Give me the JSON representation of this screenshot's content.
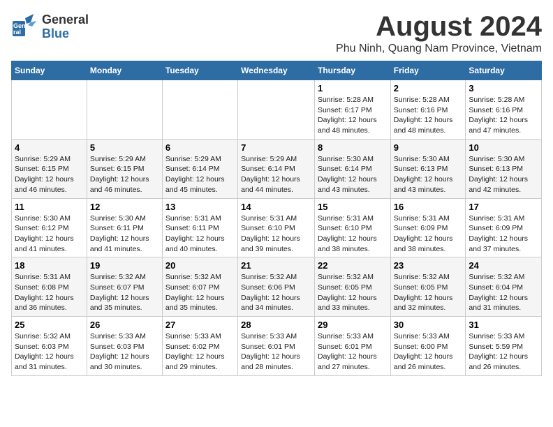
{
  "logo": {
    "line1": "General",
    "line2": "Blue"
  },
  "title": "August 2024",
  "location": "Phu Ninh, Quang Nam Province, Vietnam",
  "days_of_week": [
    "Sunday",
    "Monday",
    "Tuesday",
    "Wednesday",
    "Thursday",
    "Friday",
    "Saturday"
  ],
  "weeks": [
    [
      {
        "day": "",
        "info": ""
      },
      {
        "day": "",
        "info": ""
      },
      {
        "day": "",
        "info": ""
      },
      {
        "day": "",
        "info": ""
      },
      {
        "day": "1",
        "info": "Sunrise: 5:28 AM\nSunset: 6:17 PM\nDaylight: 12 hours\nand 48 minutes."
      },
      {
        "day": "2",
        "info": "Sunrise: 5:28 AM\nSunset: 6:16 PM\nDaylight: 12 hours\nand 48 minutes."
      },
      {
        "day": "3",
        "info": "Sunrise: 5:28 AM\nSunset: 6:16 PM\nDaylight: 12 hours\nand 47 minutes."
      }
    ],
    [
      {
        "day": "4",
        "info": "Sunrise: 5:29 AM\nSunset: 6:15 PM\nDaylight: 12 hours\nand 46 minutes."
      },
      {
        "day": "5",
        "info": "Sunrise: 5:29 AM\nSunset: 6:15 PM\nDaylight: 12 hours\nand 46 minutes."
      },
      {
        "day": "6",
        "info": "Sunrise: 5:29 AM\nSunset: 6:14 PM\nDaylight: 12 hours\nand 45 minutes."
      },
      {
        "day": "7",
        "info": "Sunrise: 5:29 AM\nSunset: 6:14 PM\nDaylight: 12 hours\nand 44 minutes."
      },
      {
        "day": "8",
        "info": "Sunrise: 5:30 AM\nSunset: 6:14 PM\nDaylight: 12 hours\nand 43 minutes."
      },
      {
        "day": "9",
        "info": "Sunrise: 5:30 AM\nSunset: 6:13 PM\nDaylight: 12 hours\nand 43 minutes."
      },
      {
        "day": "10",
        "info": "Sunrise: 5:30 AM\nSunset: 6:13 PM\nDaylight: 12 hours\nand 42 minutes."
      }
    ],
    [
      {
        "day": "11",
        "info": "Sunrise: 5:30 AM\nSunset: 6:12 PM\nDaylight: 12 hours\nand 41 minutes."
      },
      {
        "day": "12",
        "info": "Sunrise: 5:30 AM\nSunset: 6:11 PM\nDaylight: 12 hours\nand 41 minutes."
      },
      {
        "day": "13",
        "info": "Sunrise: 5:31 AM\nSunset: 6:11 PM\nDaylight: 12 hours\nand 40 minutes."
      },
      {
        "day": "14",
        "info": "Sunrise: 5:31 AM\nSunset: 6:10 PM\nDaylight: 12 hours\nand 39 minutes."
      },
      {
        "day": "15",
        "info": "Sunrise: 5:31 AM\nSunset: 6:10 PM\nDaylight: 12 hours\nand 38 minutes."
      },
      {
        "day": "16",
        "info": "Sunrise: 5:31 AM\nSunset: 6:09 PM\nDaylight: 12 hours\nand 38 minutes."
      },
      {
        "day": "17",
        "info": "Sunrise: 5:31 AM\nSunset: 6:09 PM\nDaylight: 12 hours\nand 37 minutes."
      }
    ],
    [
      {
        "day": "18",
        "info": "Sunrise: 5:31 AM\nSunset: 6:08 PM\nDaylight: 12 hours\nand 36 minutes."
      },
      {
        "day": "19",
        "info": "Sunrise: 5:32 AM\nSunset: 6:07 PM\nDaylight: 12 hours\nand 35 minutes."
      },
      {
        "day": "20",
        "info": "Sunrise: 5:32 AM\nSunset: 6:07 PM\nDaylight: 12 hours\nand 35 minutes."
      },
      {
        "day": "21",
        "info": "Sunrise: 5:32 AM\nSunset: 6:06 PM\nDaylight: 12 hours\nand 34 minutes."
      },
      {
        "day": "22",
        "info": "Sunrise: 5:32 AM\nSunset: 6:05 PM\nDaylight: 12 hours\nand 33 minutes."
      },
      {
        "day": "23",
        "info": "Sunrise: 5:32 AM\nSunset: 6:05 PM\nDaylight: 12 hours\nand 32 minutes."
      },
      {
        "day": "24",
        "info": "Sunrise: 5:32 AM\nSunset: 6:04 PM\nDaylight: 12 hours\nand 31 minutes."
      }
    ],
    [
      {
        "day": "25",
        "info": "Sunrise: 5:32 AM\nSunset: 6:03 PM\nDaylight: 12 hours\nand 31 minutes."
      },
      {
        "day": "26",
        "info": "Sunrise: 5:33 AM\nSunset: 6:03 PM\nDaylight: 12 hours\nand 30 minutes."
      },
      {
        "day": "27",
        "info": "Sunrise: 5:33 AM\nSunset: 6:02 PM\nDaylight: 12 hours\nand 29 minutes."
      },
      {
        "day": "28",
        "info": "Sunrise: 5:33 AM\nSunset: 6:01 PM\nDaylight: 12 hours\nand 28 minutes."
      },
      {
        "day": "29",
        "info": "Sunrise: 5:33 AM\nSunset: 6:01 PM\nDaylight: 12 hours\nand 27 minutes."
      },
      {
        "day": "30",
        "info": "Sunrise: 5:33 AM\nSunset: 6:00 PM\nDaylight: 12 hours\nand 26 minutes."
      },
      {
        "day": "31",
        "info": "Sunrise: 5:33 AM\nSunset: 5:59 PM\nDaylight: 12 hours\nand 26 minutes."
      }
    ]
  ]
}
